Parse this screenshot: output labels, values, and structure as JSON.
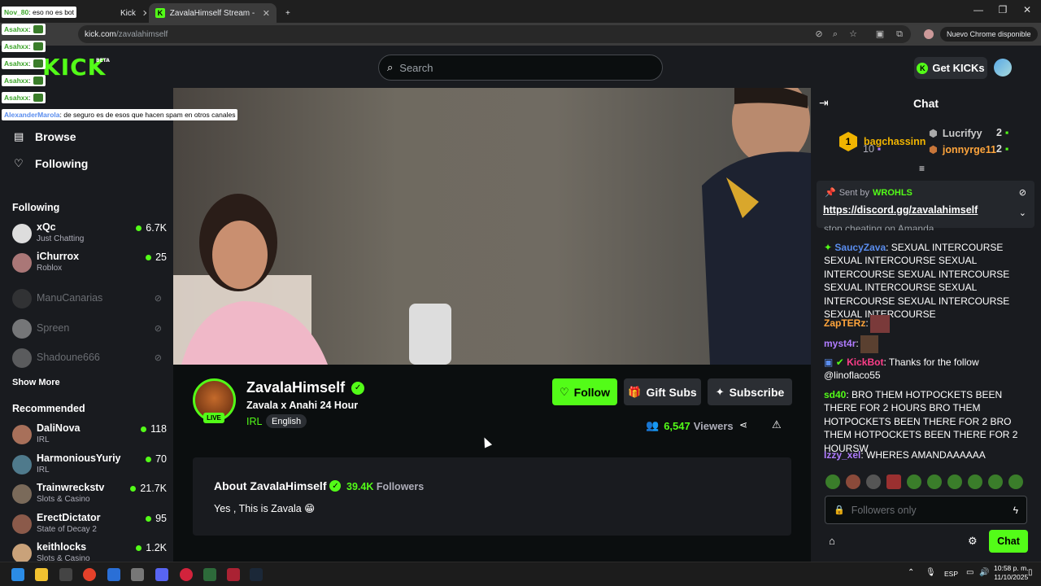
{
  "browser": {
    "tabs": [
      {
        "label": "Kick"
      },
      {
        "label": "ZavalaHimself Stream - Watch Live on Kick"
      }
    ],
    "new_tab": "+",
    "url_host": "kick.com",
    "url_path": "/zavalahimself",
    "update_label": "Nuevo Chrome disponible"
  },
  "overlay": {
    "first": {
      "user": "Nov_80",
      "text": ": eso no es bot"
    },
    "repeats": [
      {
        "user": "Asahxx",
        "text": ":"
      },
      {
        "user": "Asahxx",
        "text": ":"
      },
      {
        "user": "Asahxx",
        "text": ":"
      },
      {
        "user": "Asahxx",
        "text": ":"
      },
      {
        "user": "Asahxx",
        "text": ":"
      }
    ],
    "last": {
      "user": "AlexanderMarola",
      "text": ": de seguro es de esos que hacen spam en otros canales"
    }
  },
  "header": {
    "logo": "KICK",
    "logo_beta": "BETA",
    "search_placeholder": "Search",
    "get_kicks": "Get KICKs"
  },
  "sidebar": {
    "browse": "Browse",
    "following_link": "Following",
    "following_header": "Following",
    "following": [
      {
        "name": "xQc",
        "category": "Just Chatting",
        "viewers": "6.7K",
        "live": true
      },
      {
        "name": "iChurrox",
        "category": "Roblox",
        "viewers": "25",
        "live": true
      },
      {
        "name": "ManuCanarias",
        "category": "",
        "viewers": "",
        "live": false
      },
      {
        "name": "Spreen",
        "category": "",
        "viewers": "",
        "live": false
      },
      {
        "name": "Shadoune666",
        "category": "",
        "viewers": "",
        "live": false
      }
    ],
    "show_more": "Show More",
    "recommended_header": "Recommended",
    "recommended": [
      {
        "name": "DaliNova",
        "category": "IRL",
        "viewers": "118"
      },
      {
        "name": "HarmoniousYuriy",
        "category": "IRL",
        "viewers": "70"
      },
      {
        "name": "Trainwreckstv",
        "category": "Slots & Casino",
        "viewers": "21.7K"
      },
      {
        "name": "ErectDictator",
        "category": "State of Decay 2",
        "viewers": "95"
      },
      {
        "name": "keithlocks",
        "category": "Slots & Casino",
        "viewers": "1.2K"
      }
    ]
  },
  "channel": {
    "name": "ZavalaHimself",
    "live_badge": "LIVE",
    "title": "Zavala x Anahi 24 Hour",
    "category": "IRL",
    "language": "English",
    "follow": "Follow",
    "gift_subs": "Gift Subs",
    "subscribe": "Subscribe",
    "viewers_count": "6,547",
    "viewers_label": "Viewers",
    "about_title": "About ZavalaHimself",
    "followers_count": "39.4K",
    "followers_label": "Followers",
    "bio": "Yes , This is Zavala 😁"
  },
  "chat": {
    "title": "Chat",
    "top_gifters": [
      {
        "rank": "1",
        "name": "bagchassinn",
        "count": "10"
      },
      {
        "rank": "",
        "name": "Lucrifyy",
        "count": "2"
      },
      {
        "rank": "",
        "name": "jonnyrge11",
        "count": "2"
      }
    ],
    "pinned": {
      "sent_by_label": "Sent by",
      "sender": "WROHLS",
      "link": "https://discord.gg/zavalahimself"
    },
    "partial_line": "stop cheating on Amanda",
    "messages": [
      {
        "user": "SaucyZava",
        "color": "#5a8dee",
        "text": ": SEXUAL INTERCOURSE SEXUAL INTERCOURSE SEXUAL INTERCOURSE SEXUAL INTERCOURSE SEXUAL INTERCOURSE SEXUAL INTERCOURSE SEXUAL INTERCOURSE SEXUAL INTERCOURSE"
      },
      {
        "user": "ZapTERz",
        "color": "#ffa53c",
        "text": ":"
      },
      {
        "user": "myst4r",
        "color": "#b07cff",
        "text": ":"
      },
      {
        "user": "KickBot",
        "color": "#ff3e8a",
        "text": ": Thanks for the follow @linoflaco55"
      },
      {
        "user": "sd40",
        "color": "#53fc18",
        "text": ": BRO THEM HOTPOCKETS BEEN THERE FOR 2 HOURS BRO THEM HOTPOCKETS BEEN THERE FOR 2 BRO THEM HOTPOCKETS BEEN THERE FOR 2 HOURSW"
      },
      {
        "user": "Izzy_xel",
        "color": "#b07cff",
        "text": ": WHERES AMANDAAAAAA"
      }
    ],
    "input_placeholder": "Followers only",
    "send": "Chat"
  },
  "taskbar": {
    "lang": "ESP",
    "time": "10:58 p. m.",
    "date": "11/10/2025"
  },
  "colors": {
    "accent": "#53fc18",
    "bg": "#0b0e0f",
    "panel": "#191b1f"
  }
}
